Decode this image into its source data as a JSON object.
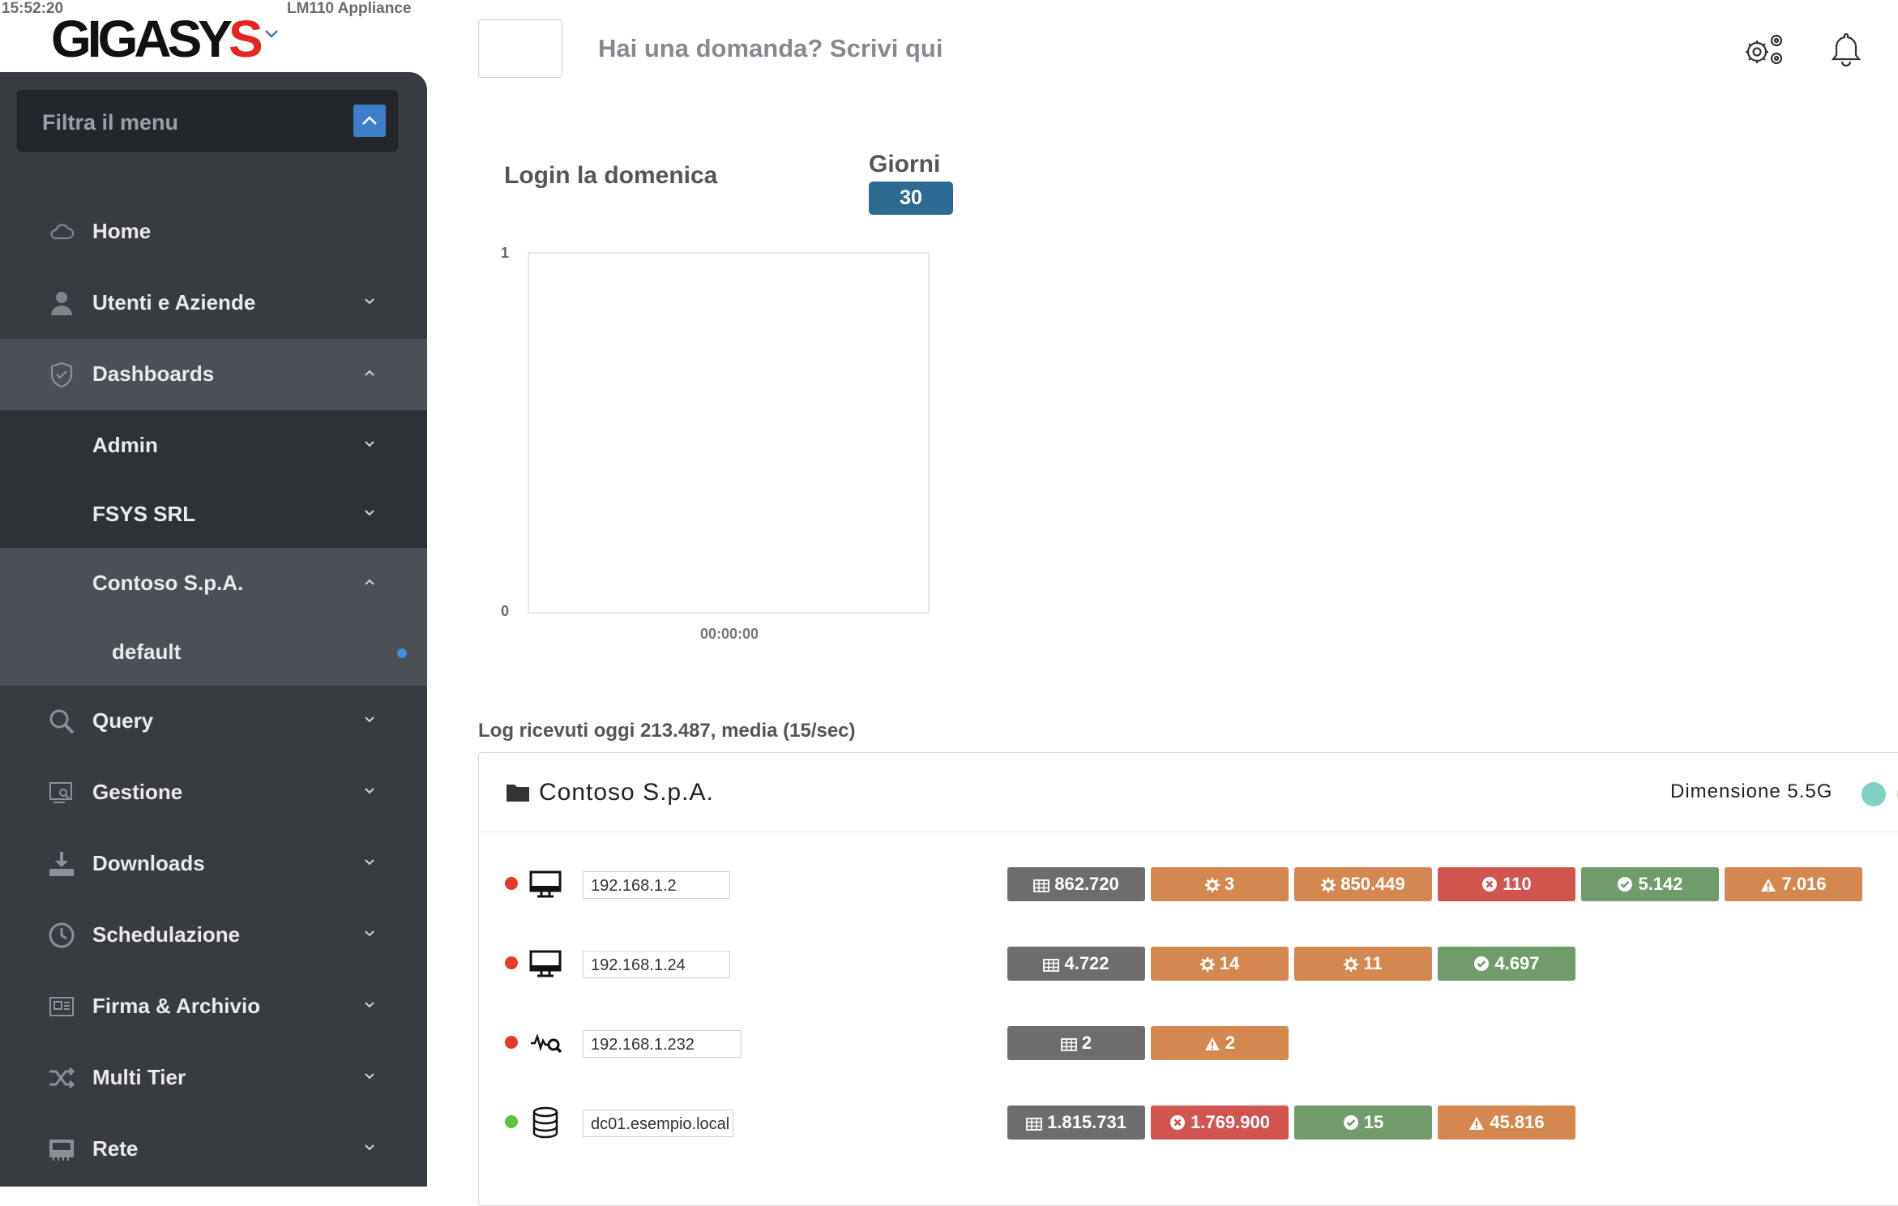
{
  "header": {
    "clock": "15:52:20",
    "appliance": "LM110 Appliance",
    "logo_main": "GIGASY",
    "logo_accent": "S",
    "search_placeholder": "Hai una domanda? Scrivi qui",
    "icons": [
      "gear-cluster-icon",
      "bell-icon"
    ]
  },
  "sidebar": {
    "filter_placeholder": "Filtra il menu",
    "items": [
      {
        "label": "Home",
        "icon": "cloud-icon"
      },
      {
        "label": "Utenti e Aziende",
        "icon": "user-icon"
      },
      {
        "label": "Dashboards",
        "icon": "shield-icon"
      },
      {
        "label": "Admin"
      },
      {
        "label": "FSYS SRL"
      },
      {
        "label": "Contoso S.p.A."
      },
      {
        "label": "default"
      },
      {
        "label": "Query",
        "icon": "search-icon"
      },
      {
        "label": "Gestione",
        "icon": "monitor-search-icon"
      },
      {
        "label": "Downloads",
        "icon": "download-icon"
      },
      {
        "label": "Schedulazione",
        "icon": "clock-icon"
      },
      {
        "label": "Firma & Archivio",
        "icon": "archive-icon"
      },
      {
        "label": "Multi Tier",
        "icon": "shuffle-icon"
      },
      {
        "label": "Rete",
        "icon": "network-card-icon"
      }
    ]
  },
  "chart": {
    "title": "Login la domenica",
    "days_label": "Giorni",
    "days_value": "30"
  },
  "chart_data": {
    "type": "line",
    "title": "Login la domenica",
    "x": [
      "00:00:00"
    ],
    "series": [
      {
        "values": [
          0
        ]
      }
    ],
    "ylim": [
      0,
      1
    ],
    "yticks": [
      "1",
      "0"
    ],
    "xticks": [
      "00:00:00"
    ],
    "grid": false
  },
  "logs": {
    "summary": "Log ricevuti oggi 213.487, media (15/sec)",
    "company": "Contoso S.p.A.",
    "size": "Dimensione 5.5G",
    "colors": {
      "grey": "#6d6d6d",
      "orange": "#d4874f",
      "red": "#d2544f",
      "green": "#6f9c6a",
      "status_red": "#e53a2c",
      "status_green": "#5cc23c"
    },
    "rows": [
      {
        "status": "red",
        "icon": "desktop-icon",
        "host": "192.168.1.2",
        "badges": [
          {
            "kind": "grey",
            "icon": "table-icon",
            "value": "862.720"
          },
          {
            "kind": "orange",
            "icon": "cog-icon",
            "value": "3"
          },
          {
            "kind": "orange",
            "icon": "cog-icon",
            "value": "850.449"
          },
          {
            "kind": "red",
            "icon": "x-circle-icon",
            "value": "110"
          },
          {
            "kind": "green",
            "icon": "check-circle-icon",
            "value": "5.142"
          },
          {
            "kind": "orange",
            "icon": "warning-icon",
            "value": "7.016"
          }
        ]
      },
      {
        "status": "red",
        "icon": "desktop-icon",
        "host": "192.168.1.24",
        "badges": [
          {
            "kind": "grey",
            "icon": "table-icon",
            "value": "4.722"
          },
          {
            "kind": "orange",
            "icon": "cog-icon",
            "value": "14"
          },
          {
            "kind": "orange",
            "icon": "cog-icon",
            "value": "11"
          },
          {
            "kind": "green",
            "icon": "check-circle-icon",
            "value": "4.697"
          }
        ]
      },
      {
        "status": "red",
        "icon": "wave-search-icon",
        "host": "192.168.1.232",
        "badges": [
          {
            "kind": "grey",
            "icon": "table-icon",
            "value": "2"
          },
          {
            "kind": "orange",
            "icon": "warning-icon",
            "value": "2"
          }
        ]
      },
      {
        "status": "green",
        "icon": "database-icon",
        "host": "dc01.esempio.local",
        "badges": [
          {
            "kind": "grey",
            "icon": "table-icon",
            "value": "1.815.731"
          },
          {
            "kind": "red",
            "icon": "x-circle-icon",
            "value": "1.769.900"
          },
          {
            "kind": "green",
            "icon": "check-circle-icon",
            "value": "15"
          },
          {
            "kind": "orange",
            "icon": "warning-icon",
            "value": "45.816"
          }
        ]
      }
    ]
  }
}
